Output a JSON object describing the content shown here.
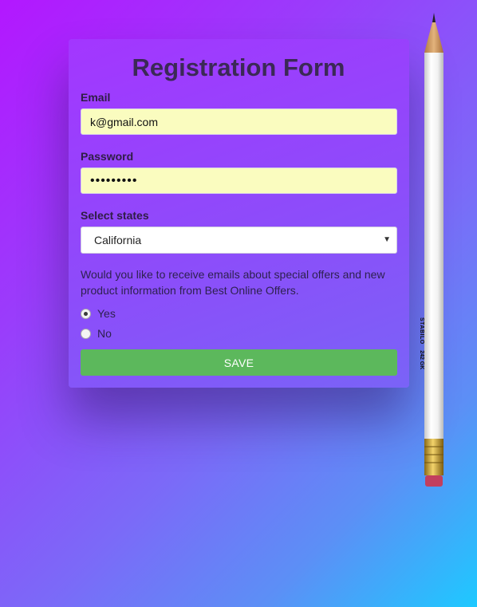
{
  "form": {
    "title": "Registration Form",
    "email_label": "Email",
    "email_value": "k@gmail.com",
    "password_label": "Password",
    "password_mask": "•••••••••",
    "state_label": "Select states",
    "state_value": "California",
    "question": "Would you like to receive emails about special offers and new product information from Best Online Offers.",
    "options": [
      {
        "label": "Yes",
        "checked": true
      },
      {
        "label": "No",
        "checked": false
      }
    ],
    "save_label": "SAVE"
  },
  "pencil": {
    "brand": "STABILO",
    "model": "242 GK"
  },
  "colors": {
    "button": "#5cb85c",
    "input_autofill": "#fafcbf"
  }
}
